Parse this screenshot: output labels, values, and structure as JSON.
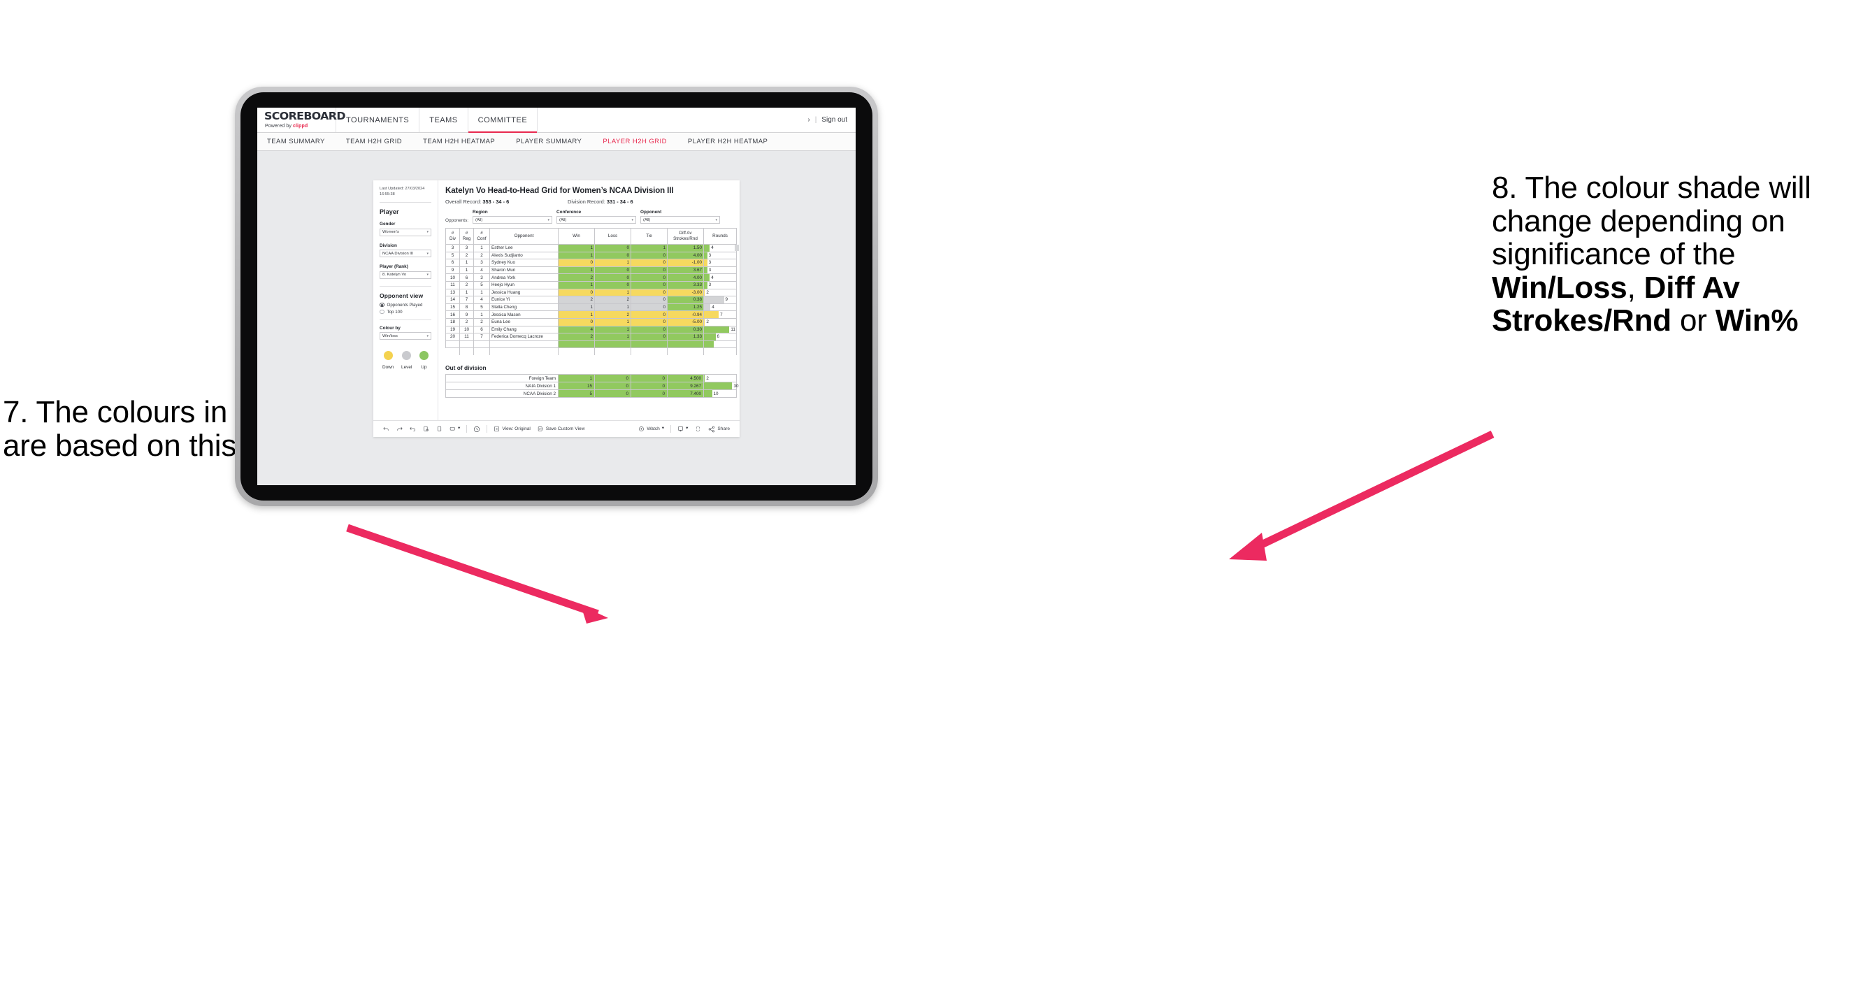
{
  "annotations": {
    "left": {
      "number": "7.",
      "text": "The colours in the grid are based on this selection"
    },
    "right": {
      "number": "8.",
      "line1": "The colour shade will change depending on significance of the ",
      "bold1": "Win/Loss",
      "mid1": ", ",
      "bold2": "Diff Av Strokes/Rnd",
      "mid2": " or ",
      "bold3": "Win%"
    },
    "arrow_color": "#ec2a60"
  },
  "app": {
    "brand": {
      "title": "SCOREBOARD",
      "powered_prefix": "Powered by ",
      "powered_name": "clippd"
    },
    "main_nav": [
      {
        "label": "TOURNAMENTS",
        "active": false
      },
      {
        "label": "TEAMS",
        "active": false
      },
      {
        "label": "COMMITTEE",
        "active": true
      }
    ],
    "top_right": {
      "chevron": "›",
      "divider": "|",
      "sign_out": "Sign out"
    },
    "sub_nav": [
      {
        "label": "TEAM SUMMARY",
        "active": false
      },
      {
        "label": "TEAM H2H GRID",
        "active": false
      },
      {
        "label": "TEAM H2H HEATMAP",
        "active": false
      },
      {
        "label": "PLAYER SUMMARY",
        "active": false
      },
      {
        "label": "PLAYER H2H GRID",
        "active": true
      },
      {
        "label": "PLAYER H2H HEATMAP",
        "active": false
      }
    ]
  },
  "sidebar": {
    "last_updated": "Last Updated: 27/03/2024 16:55:38",
    "player_heading": "Player",
    "gender": {
      "label": "Gender",
      "value": "Women’s"
    },
    "division": {
      "label": "Division",
      "value": "NCAA Division III"
    },
    "player_rank": {
      "label": "Player (Rank)",
      "value": "8. Katelyn Vo"
    },
    "opponent_view": {
      "heading": "Opponent view",
      "options": [
        {
          "label": "Opponents Played",
          "selected": true
        },
        {
          "label": "Top 100",
          "selected": false
        }
      ]
    },
    "colour_by": {
      "label": "Colour by",
      "value": "Win/loss"
    },
    "legend": [
      {
        "caption": "Down",
        "color": "#f4d24f"
      },
      {
        "caption": "Level",
        "color": "#c9cace"
      },
      {
        "caption": "Up",
        "color": "#8cc662"
      }
    ]
  },
  "report": {
    "title": "Katelyn Vo Head-to-Head Grid for Women’s NCAA Division III",
    "overall_label": "Overall Record: ",
    "overall_value": "353 -  34 - 6",
    "division_label": "Division Record: ",
    "division_value": "331 -  34 - 6",
    "opponents_label": "Opponents:",
    "filters": [
      {
        "label": "Region",
        "value": "(All)"
      },
      {
        "label": "Conference",
        "value": "(All)"
      },
      {
        "label": "Opponent",
        "value": "(All)"
      }
    ]
  },
  "chart_data": {
    "type": "table",
    "title": "Katelyn Vo Head-to-Head Grid for Women’s NCAA Division III",
    "columns": [
      "# Div",
      "# Reg",
      "# Conf",
      "Opponent",
      "Win",
      "Loss",
      "Tie",
      "Diff Av Strokes/Rnd",
      "Rounds"
    ],
    "rows": [
      {
        "div": "3",
        "reg": "3",
        "conf": "1",
        "opponent": "Esther Lee",
        "win": "1",
        "loss": "0",
        "tie": "1",
        "diff": "1.50",
        "rounds": "4",
        "shade": "g",
        "rounds_shade": "g",
        "bar_pct": 18
      },
      {
        "div": "5",
        "reg": "2",
        "conf": "2",
        "opponent": "Alexis Sudjianto",
        "win": "1",
        "loss": "0",
        "tie": "0",
        "diff": "4.00",
        "rounds": "3",
        "shade": "g",
        "rounds_shade": "g",
        "bar_pct": 10
      },
      {
        "div": "6",
        "reg": "1",
        "conf": "3",
        "opponent": "Sydney Kuo",
        "win": "0",
        "loss": "1",
        "tie": "0",
        "diff": "-1.00",
        "rounds": "3",
        "shade": "y",
        "rounds_shade": "y",
        "bar_pct": 10
      },
      {
        "div": "9",
        "reg": "1",
        "conf": "4",
        "opponent": "Sharon Mun",
        "win": "1",
        "loss": "0",
        "tie": "0",
        "diff": "3.67",
        "rounds": "3",
        "shade": "g",
        "rounds_shade": "g",
        "bar_pct": 10
      },
      {
        "div": "10",
        "reg": "6",
        "conf": "3",
        "opponent": "Andrea York",
        "win": "2",
        "loss": "0",
        "tie": "0",
        "diff": "4.00",
        "rounds": "4",
        "shade": "g",
        "rounds_shade": "g",
        "bar_pct": 18
      },
      {
        "div": "11",
        "reg": "2",
        "conf": "5",
        "opponent": "Heejo Hyun",
        "win": "1",
        "loss": "0",
        "tie": "0",
        "diff": "3.33",
        "rounds": "3",
        "shade": "g",
        "rounds_shade": "g",
        "bar_pct": 10
      },
      {
        "div": "13",
        "reg": "1",
        "conf": "1",
        "opponent": "Jessica Huang",
        "win": "0",
        "loss": "1",
        "tie": "0",
        "diff": "-3.00",
        "rounds": "2",
        "shade": "y",
        "rounds_shade": "y",
        "bar_pct": 3
      },
      {
        "div": "14",
        "reg": "7",
        "conf": "4",
        "opponent": "Eunice Yi",
        "win": "2",
        "loss": "2",
        "tie": "0",
        "diff": "0.38",
        "rounds": "9",
        "shade": "n",
        "diff_shade": "g",
        "rounds_shade": "n",
        "bar_pct": 62
      },
      {
        "div": "15",
        "reg": "8",
        "conf": "5",
        "opponent": "Stella Cheng",
        "win": "1",
        "loss": "1",
        "tie": "0",
        "diff": "1.25",
        "rounds": "4",
        "shade": "n",
        "diff_shade": "g",
        "rounds_shade": "n",
        "bar_pct": 20
      },
      {
        "div": "16",
        "reg": "9",
        "conf": "1",
        "opponent": "Jessica Mason",
        "win": "1",
        "loss": "2",
        "tie": "0",
        "diff": "-0.94",
        "rounds": "7",
        "shade": "y",
        "rounds_shade": "y",
        "bar_pct": 46
      },
      {
        "div": "18",
        "reg": "2",
        "conf": "2",
        "opponent": "Euna Lee",
        "win": "0",
        "loss": "1",
        "tie": "0",
        "diff": "-5.00",
        "rounds": "2",
        "shade": "y",
        "rounds_shade": "y",
        "bar_pct": 3
      },
      {
        "div": "19",
        "reg": "10",
        "conf": "6",
        "opponent": "Emily Chang",
        "win": "4",
        "loss": "1",
        "tie": "0",
        "diff": "0.30",
        "rounds": "11",
        "shade": "g",
        "rounds_shade": "g",
        "bar_pct": 79
      },
      {
        "div": "20",
        "reg": "11",
        "conf": "7",
        "opponent": "Federica Domecq Lacroze",
        "win": "2",
        "loss": "1",
        "tie": "0",
        "diff": "1.33",
        "rounds": "6",
        "shade": "g",
        "rounds_shade": "g",
        "bar_pct": 36
      }
    ],
    "out_of_division": {
      "title": "Out of division",
      "rows": [
        {
          "name": "Foreign Team",
          "win": "1",
          "loss": "0",
          "tie": "0",
          "diff": "4.500",
          "rounds": "2",
          "shade": "g",
          "bar_pct": 3
        },
        {
          "name": "NAIA Division 1",
          "win": "15",
          "loss": "0",
          "tie": "0",
          "diff": "9.267",
          "rounds": "30",
          "shade": "g",
          "bar_pct": 88
        },
        {
          "name": "NCAA Division 2",
          "win": "5",
          "loss": "0",
          "tie": "0",
          "diff": "7.400",
          "rounds": "10",
          "shade": "g",
          "bar_pct": 25
        }
      ]
    }
  },
  "toolbar": {
    "view_original": "View: Original",
    "save_custom_view": "Save Custom View",
    "watch": "Watch",
    "share": "Share",
    "caret": "▾"
  }
}
